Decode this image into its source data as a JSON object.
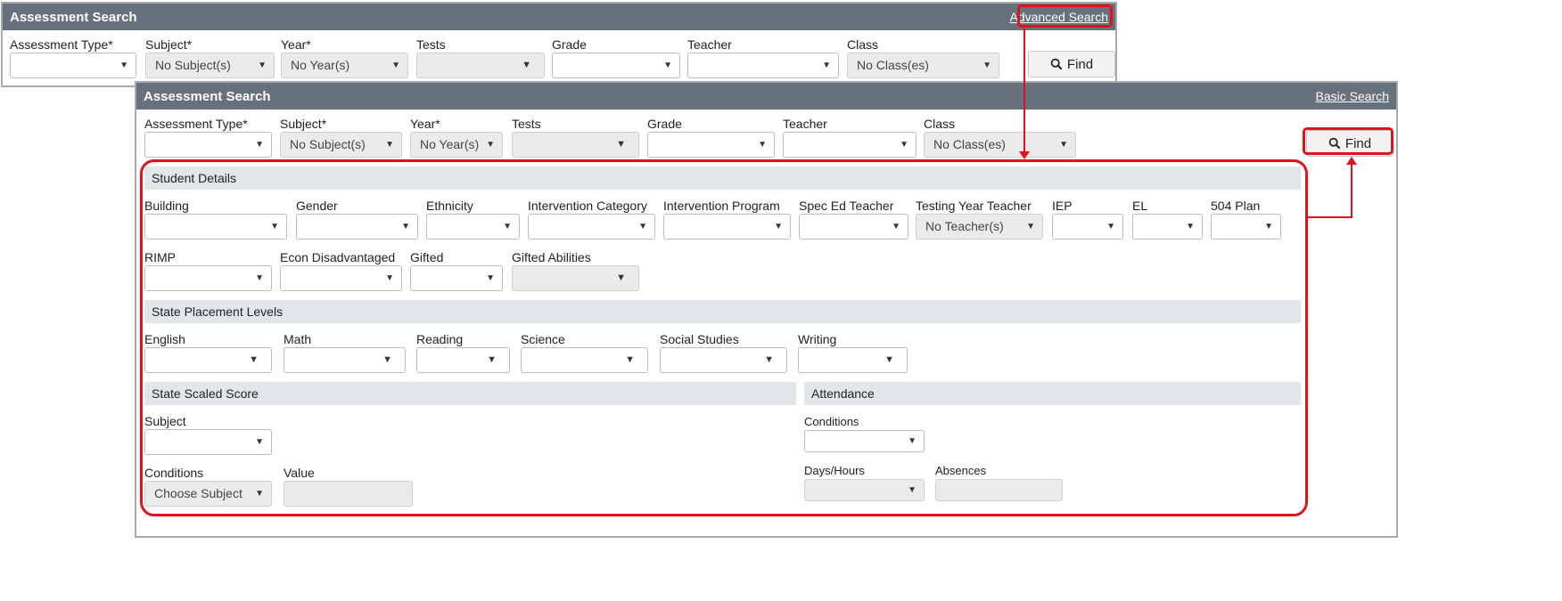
{
  "basic_panel": {
    "title": "Assessment Search",
    "advanced_link": "Advanced Search",
    "fields": [
      {
        "label": "Assessment Type*",
        "value": "",
        "disabled": false
      },
      {
        "label": "Subject*",
        "value": "No Subject(s)",
        "disabled": true
      },
      {
        "label": "Year*",
        "value": "No Year(s)",
        "disabled": true
      },
      {
        "label": "Tests",
        "value": "",
        "disabled": true
      },
      {
        "label": "Grade",
        "value": "",
        "disabled": false
      },
      {
        "label": "Teacher",
        "value": "",
        "disabled": false
      },
      {
        "label": "Class",
        "value": "No Class(es)",
        "disabled": true
      }
    ],
    "find_label": "Find"
  },
  "advanced_panel": {
    "title": "Assessment Search",
    "basic_link": "Basic Search",
    "fields": [
      {
        "label": "Assessment Type*",
        "value": ""
      },
      {
        "label": "Subject*",
        "value": "No Subject(s)"
      },
      {
        "label": "Year*",
        "value": "No Year(s)"
      },
      {
        "label": "Tests",
        "value": ""
      },
      {
        "label": "Grade",
        "value": ""
      },
      {
        "label": "Teacher",
        "value": ""
      },
      {
        "label": "Class",
        "value": "No Class(es)"
      }
    ],
    "find_label": "Find",
    "student_details": {
      "title": "Student Details",
      "row1": [
        {
          "label": "Building",
          "value": ""
        },
        {
          "label": "Gender",
          "value": ""
        },
        {
          "label": "Ethnicity",
          "value": ""
        },
        {
          "label": "Intervention Category",
          "value": ""
        },
        {
          "label": "Intervention Program",
          "value": ""
        },
        {
          "label": "Spec Ed Teacher",
          "value": ""
        },
        {
          "label": "Testing Year Teacher",
          "value": "No Teacher(s)"
        },
        {
          "label": "IEP",
          "value": ""
        },
        {
          "label": "EL",
          "value": ""
        },
        {
          "label": "504 Plan",
          "value": ""
        }
      ],
      "row2": [
        {
          "label": "RIMP",
          "value": ""
        },
        {
          "label": "Econ Disadvantaged",
          "value": ""
        },
        {
          "label": "Gifted",
          "value": ""
        },
        {
          "label": "Gifted Abilities",
          "value": ""
        }
      ]
    },
    "state_placement": {
      "title": "State Placement Levels",
      "fields": [
        {
          "label": "English",
          "value": ""
        },
        {
          "label": "Math",
          "value": ""
        },
        {
          "label": "Reading",
          "value": ""
        },
        {
          "label": "Science",
          "value": ""
        },
        {
          "label": "Social Studies",
          "value": ""
        },
        {
          "label": "Writing",
          "value": ""
        }
      ]
    },
    "state_scaled": {
      "title": "State Scaled Score",
      "subject_label": "Subject",
      "subject_value": "",
      "conditions_label": "Conditions",
      "conditions_value": "Choose Subject",
      "value_label": "Value"
    },
    "attendance": {
      "title": "Attendance",
      "conditions_label": "Conditions",
      "conditions_value": "",
      "days_label": "Days/Hours",
      "days_value": "",
      "absences_label": "Absences"
    }
  },
  "colors": {
    "header_bg": "#66717d",
    "section_bg": "#e3e6e9",
    "highlight": "#e3111b",
    "disabled_bg": "#ebebeb"
  },
  "icons": {
    "caret": "caret-down-icon",
    "find": "search-icon"
  }
}
